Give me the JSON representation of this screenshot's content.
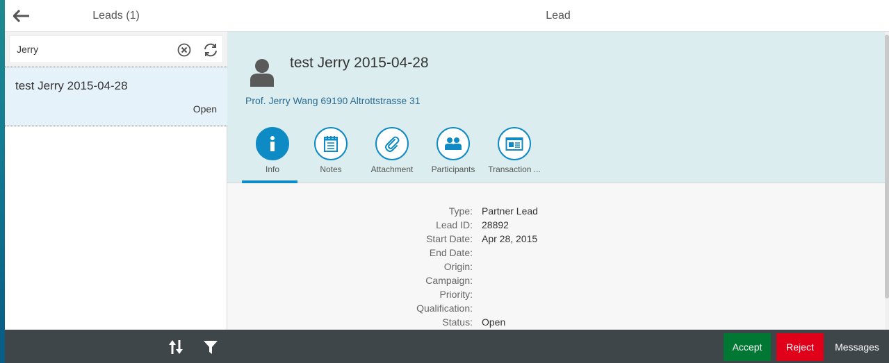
{
  "master": {
    "title": "Leads (1)",
    "search": {
      "value": "Jerry",
      "placeholder": "Search"
    },
    "items": [
      {
        "title": "test Jerry 2015-04-28",
        "status": "Open"
      }
    ]
  },
  "detail": {
    "title": "Lead",
    "object": {
      "title": "test Jerry 2015-04-28",
      "attribute": "Prof. Jerry Wang 69190 Altrottstrasse 31"
    },
    "tabs": [
      {
        "label": "Info",
        "icon": "info-icon",
        "selected": true
      },
      {
        "label": "Notes",
        "icon": "notes-icon",
        "selected": false
      },
      {
        "label": "Attachment",
        "icon": "paperclip-icon",
        "selected": false
      },
      {
        "label": "Participants",
        "icon": "group-icon",
        "selected": false
      },
      {
        "label": "Transaction ...",
        "icon": "contact-card-icon",
        "selected": false
      }
    ],
    "info": [
      {
        "label": "Type:",
        "value": "Partner Lead"
      },
      {
        "label": "Lead ID:",
        "value": "28892"
      },
      {
        "label": "Start Date:",
        "value": "Apr 28, 2015"
      },
      {
        "label": "End Date:",
        "value": ""
      },
      {
        "label": "Origin:",
        "value": ""
      },
      {
        "label": "Campaign:",
        "value": ""
      },
      {
        "label": "Priority:",
        "value": ""
      },
      {
        "label": "Qualification:",
        "value": ""
      },
      {
        "label": "Status:",
        "value": "Open"
      }
    ]
  },
  "footer": {
    "sort_icon": "sort-icon",
    "filter_icon": "filter-icon",
    "accept_label": "Accept",
    "reject_label": "Reject",
    "messages_label": "Messages"
  },
  "colors": {
    "accent": "#0e8ac5",
    "header_bg": "#dcedef",
    "selected_item_bg": "#e6f2f9",
    "footer_bg": "#3f4649",
    "accept": "#007833",
    "reject": "#e0001a"
  }
}
